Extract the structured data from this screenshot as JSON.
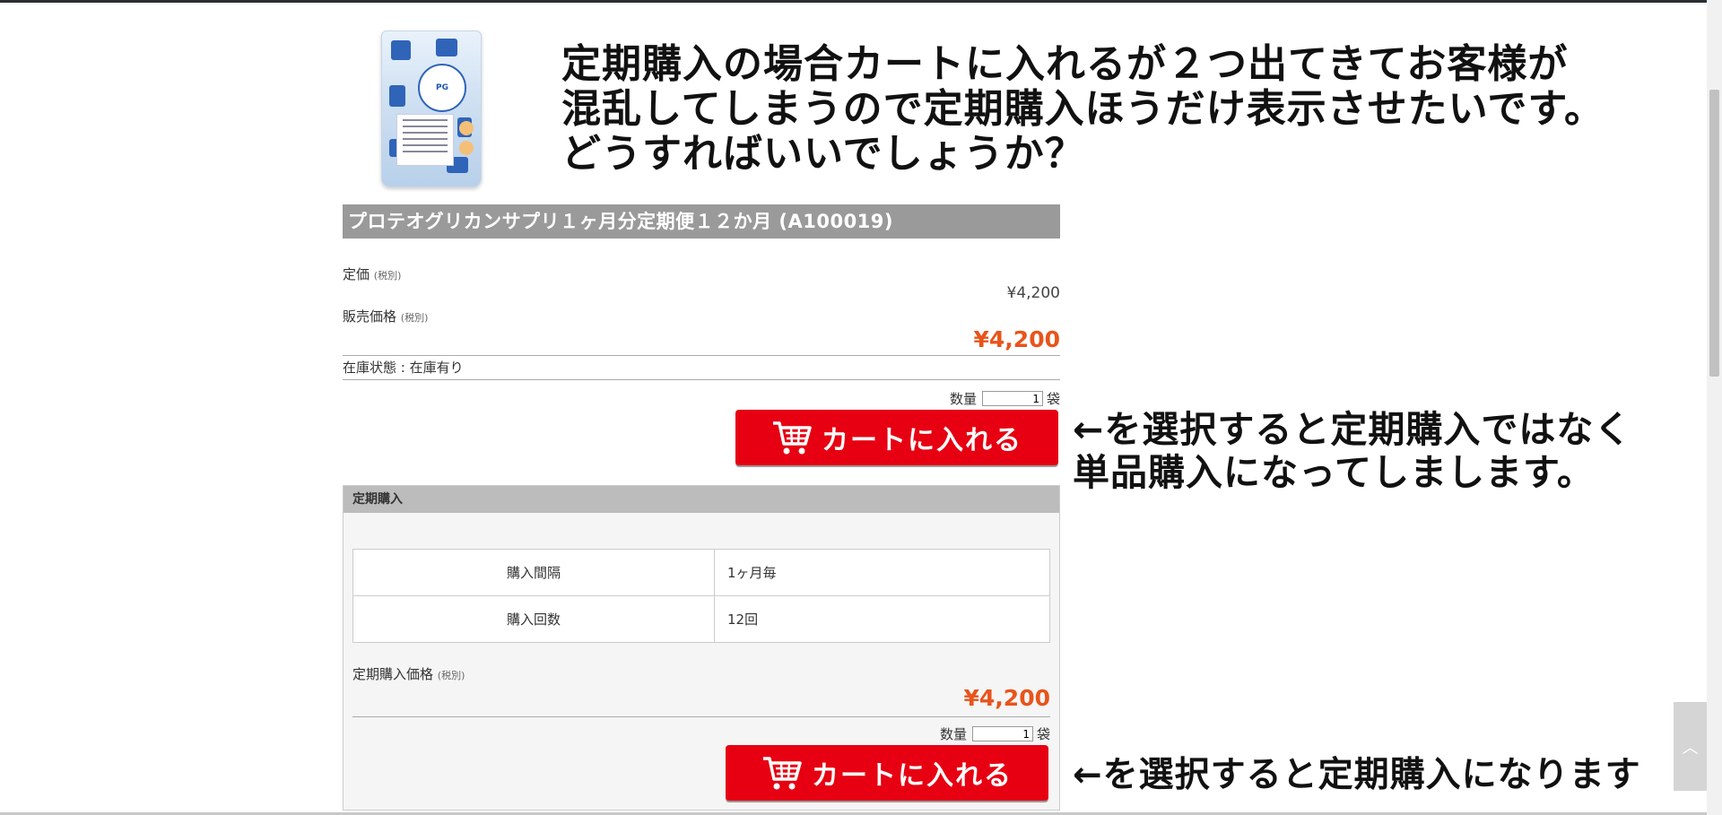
{
  "annotations": {
    "top_line1": "定期購入の場合カートに入れるが２つ出てきてお客様が",
    "top_line2": "混乱してしまうので定期購入ほうだけ表示させたいです。",
    "top_line3": "どうすればいいでしょうか？",
    "mid_line1": "←を選択すると定期購入ではなく",
    "mid_line2": "単品購入になってしまします。",
    "bottom_line": "←を選択すると定期購入になります"
  },
  "product": {
    "image_icon": "product-package-icon",
    "title": "プロテオグリカンサプリ１ヶ月分定期便１２か月  (A100019)",
    "list_price_label": "定価",
    "tax_note": "(税別)",
    "list_price": "¥4,200",
    "sale_price_label": "販売価格",
    "sale_price": "¥4,200",
    "stock": "在庫状態 : 在庫有り",
    "qty_label": "数量",
    "qty_value": "1",
    "qty_unit": "袋",
    "cart_button": "カートに入れる",
    "cart_icon": "shopping-cart-icon"
  },
  "subscription": {
    "header": "定期購入",
    "rows": [
      {
        "key": "購入間隔",
        "value": "1ヶ月毎"
      },
      {
        "key": "購入回数",
        "value": "12回"
      }
    ],
    "price_label": "定期購入価格",
    "tax_note": "(税別)",
    "price": "¥4,200",
    "qty_label": "数量",
    "qty_value": "1",
    "qty_unit": "袋",
    "cart_button": "カートに入れる"
  },
  "colors": {
    "accent_red": "#e60012",
    "price_orange": "#e8541a",
    "title_bar": "#9a9a9a"
  },
  "scroll": {
    "to_top_icon": "chevron-up-icon",
    "to_top_glyph": "︿"
  }
}
